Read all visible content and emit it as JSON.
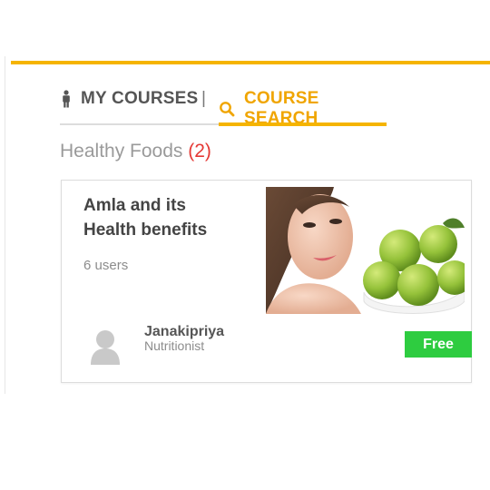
{
  "tabs": {
    "my_courses": {
      "label": "MY COURSES",
      "icon": "person-icon"
    },
    "separator": "|",
    "course_search": {
      "label": "COURSE SEARCH",
      "icon": "search-icon",
      "active": true
    }
  },
  "category": {
    "name": "Healthy Foods",
    "count": "(2)"
  },
  "course": {
    "title_line1": "Amla and its",
    "title_line2": "Health benefits",
    "users": "6 users",
    "author_name": "Janakipriya",
    "author_role": "Nutritionist",
    "price_label": "Free"
  },
  "colors": {
    "accent": "#f5b400",
    "count": "#e53935",
    "free_button": "#2ecc40"
  }
}
